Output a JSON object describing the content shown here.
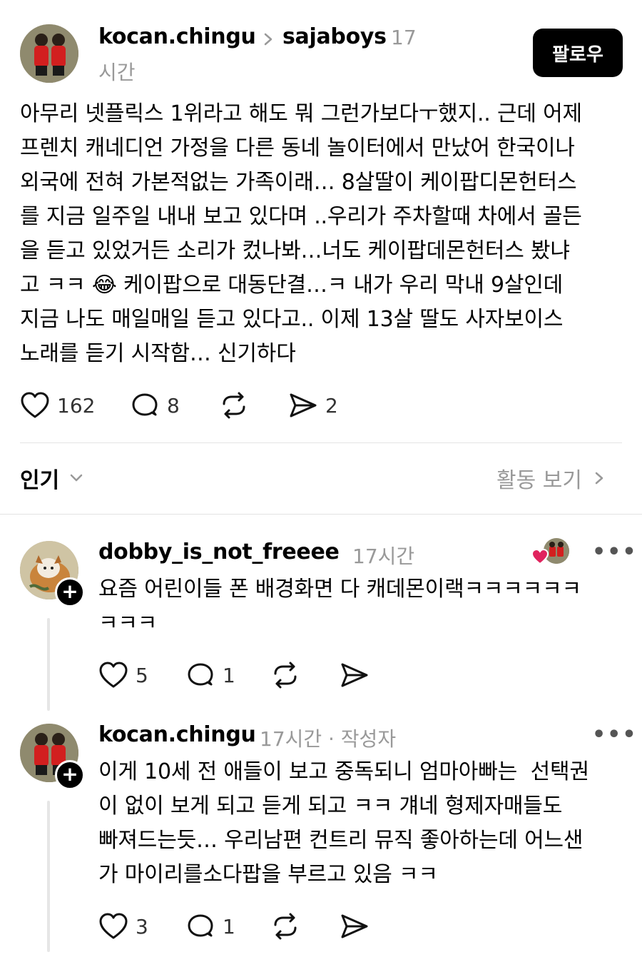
{
  "post": {
    "author": "kocan.chingu",
    "separator_icon": "chevron-right-icon",
    "reply_to": "sajaboys",
    "time_number": "17",
    "time_unit": "시간",
    "follow_label": "팔로우",
    "text": "아무리 넷플릭스 1위라고 해도 뭐 그런가보다ㅜ했지.. 근데 어제\n프렌치 캐네디언 가정을 다른 동네 놀이터에서 만났어 한국이나\n외국에 전혀 가본적없는 가족이래… 8살딸이 케이팝디몬헌터스\n를 지금 일주일 내내 보고 있다며 ..우리가 주차할때 차에서 골든\n을 듣고 있었거든 소리가 컸나봐…너도 케이팝데몬헌터스 봤냐\n고 ㅋㅋ 😂 케이팝으로 대동단결…ㅋ 내가 우리 막내 9살인데\n지금 나도 매일매일 듣고 있다고.. 이제 13살 딸도 사자보이스\n노래를 듣기 시작함… 신기하다",
    "likes": "162",
    "comments": "8",
    "shares": "2"
  },
  "sort": {
    "label": "인기",
    "activity_label": "활동 보기"
  },
  "replies": [
    {
      "author": "dobby_is_not_freeee",
      "time": "17시간",
      "badge": "",
      "text": "요즘 어린이들 폰 배경화면 다 캐데몬이랙ㅋㅋㅋㅋㅋㅋ\nㅋㅋㅋ",
      "likes": "5",
      "comments": "1",
      "liked_by_author": true
    },
    {
      "author": "kocan.chingu",
      "time": "17시간",
      "badge": "· 작성자",
      "text": "이게 10세 전 애들이 보고 중독되니 엄마아빠는  선택권\n이 없이 보게 되고 듣게 되고 ㅋㅋ 걔네 형제자매들도\n빠져드는듯… 우리남편 컨트리 뮤직 좋아하는데 어느샌\n가 마이리를소다팝을 부르고 있음 ㅋㅋ",
      "likes": "3",
      "comments": "1",
      "liked_by_author": false
    }
  ],
  "colors": {
    "like_heart": "#e0245e",
    "muted": "#999999",
    "divider": "#e3e3e3"
  }
}
